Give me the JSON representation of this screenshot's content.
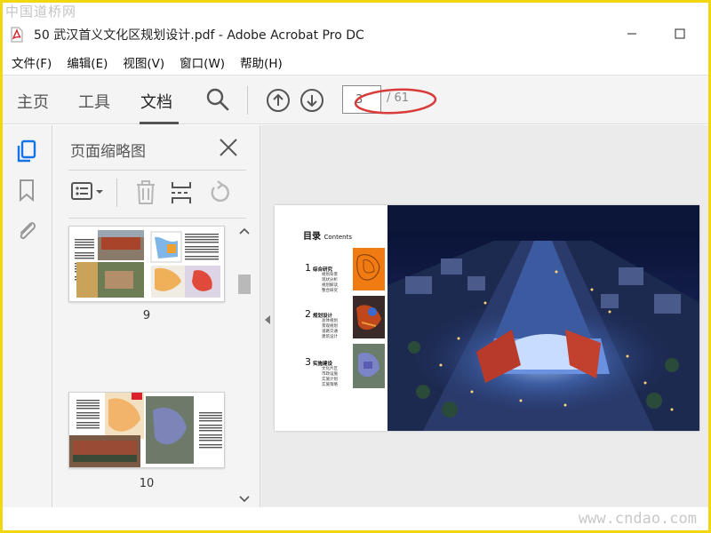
{
  "watermark": {
    "top": "中国道桥网",
    "bottom": "www.cndao.com"
  },
  "window": {
    "title": "50 武汉首义文化区规划设计.pdf - Adobe Acrobat Pro DC",
    "icon": "pdf-file-icon",
    "minimize_icon": "minimize-icon",
    "maximize_icon": "maximize-icon"
  },
  "menu": {
    "items": [
      "文件(F)",
      "编辑(E)",
      "视图(V)",
      "窗口(W)",
      "帮助(H)"
    ]
  },
  "toolbar": {
    "tabs": [
      "主页",
      "工具",
      "文档"
    ],
    "active_tab": "文档",
    "search_icon": "search-icon",
    "prev_page_icon": "arrow-up-circle-icon",
    "next_page_icon": "arrow-down-circle-icon",
    "page_current": "3",
    "page_total": "/ 61",
    "annotation_color": "#d93a3a"
  },
  "left_rail": {
    "icons": [
      "page-thumbnails-icon",
      "bookmark-icon",
      "attachment-icon"
    ],
    "active_color": "#1473e6"
  },
  "thumbnail_panel": {
    "title": "页面缩略图",
    "close_icon": "close-icon",
    "tools": [
      "options-menu-icon",
      "delete-icon",
      "insert-page-icon",
      "rotate-icon"
    ],
    "thumbnails": [
      {
        "label": "9"
      },
      {
        "label": "10"
      }
    ]
  },
  "document": {
    "toc_title": "目录",
    "toc_title_en": "Contents",
    "sections": [
      {
        "num": "1",
        "heading": "综合研究",
        "subs": [
          "规划背景",
          "现状分析",
          "规划解读",
          "整合研究"
        ],
        "img_color": "#f07b12"
      },
      {
        "num": "2",
        "heading": "规划设计",
        "subs": [
          "总体规划",
          "景观规划",
          "道路交通",
          "建筑设计"
        ],
        "img_color": "#3a2a2a"
      },
      {
        "num": "3",
        "heading": "实施建设",
        "subs": [
          "文化片区",
          "市政设施",
          "实施计划",
          "实施策略"
        ],
        "img_color": "#6a7d6a"
      }
    ],
    "render_icon": "night-aerial-render-image"
  }
}
